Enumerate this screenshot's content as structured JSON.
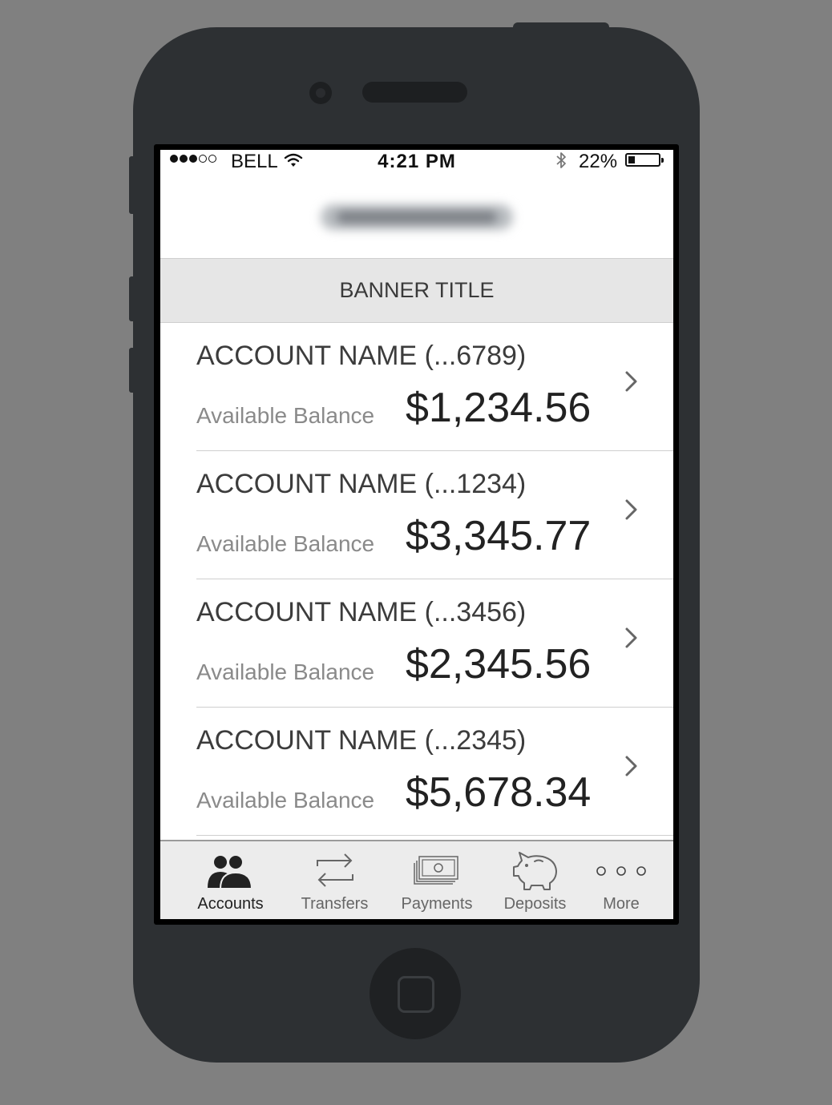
{
  "status_bar": {
    "carrier": "BELL",
    "time": "4:21 PM",
    "battery_percent": "22%",
    "battery_level": 0.22,
    "signal_bars_filled": 3,
    "signal_bars_total": 5,
    "icons": [
      "wifi-icon",
      "bluetooth-icon",
      "battery-icon"
    ]
  },
  "banner": {
    "title": "BANNER TITLE"
  },
  "accounts": [
    {
      "name": "ACCOUNT NAME (...6789)",
      "balance_label": "Available Balance",
      "balance": "$1,234.56"
    },
    {
      "name": "ACCOUNT NAME (...1234)",
      "balance_label": "Available Balance",
      "balance": "$3,345.77"
    },
    {
      "name": "ACCOUNT NAME (...3456)",
      "balance_label": "Available Balance",
      "balance": "$2,345.56"
    },
    {
      "name": "ACCOUNT NAME (...2345)",
      "balance_label": "Available Balance",
      "balance": "$5,678.34"
    }
  ],
  "tab_bar": {
    "active": "Accounts",
    "items": [
      {
        "label": "Accounts",
        "icon": "accounts-icon"
      },
      {
        "label": "Transfers",
        "icon": "transfers-icon"
      },
      {
        "label": "Payments",
        "icon": "payments-icon"
      },
      {
        "label": "Deposits",
        "icon": "deposits-icon"
      },
      {
        "label": "More",
        "icon": "more-icon"
      }
    ]
  },
  "colors": {
    "background": "#808080",
    "device": "#2d3033",
    "banner": "#e6e6e6",
    "tab_bar": "#ececec",
    "text_primary": "#222222",
    "text_secondary": "#8a8a8a"
  }
}
